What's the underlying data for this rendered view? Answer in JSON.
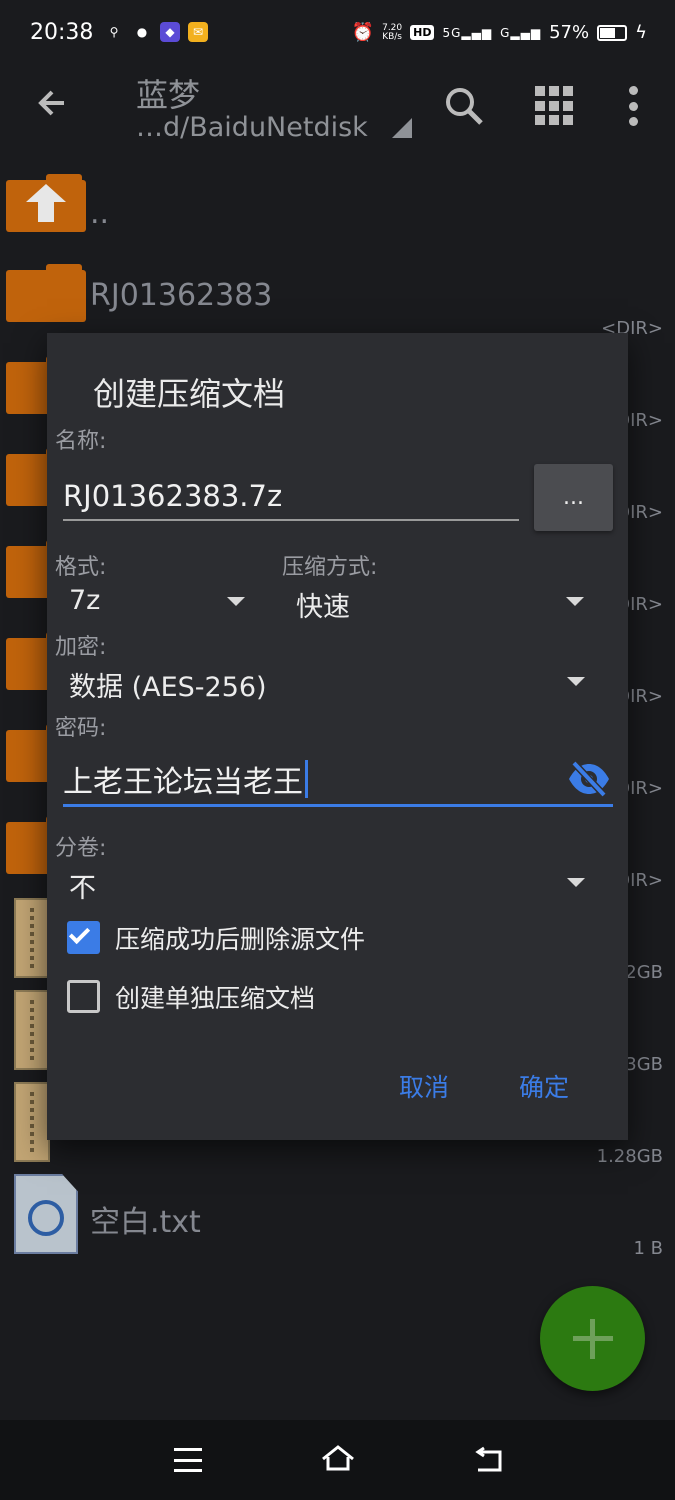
{
  "status_bar": {
    "time": "20:38",
    "net_speed_value": "7.20",
    "net_speed_unit": "KB/s",
    "hd_badge": "HD",
    "sim1": "5G",
    "sim2": "G",
    "battery_percent": "57%",
    "icons": [
      "usb-icon",
      "wechat-icon",
      "app-icon",
      "mail-icon",
      "alarm-icon",
      "charging-icon"
    ]
  },
  "toolbar": {
    "title": "蓝梦",
    "path": "…d/BaiduNetdisk"
  },
  "file_list": {
    "parent": "..",
    "items": [
      {
        "name": "RJ01362383",
        "size": "<DIR>"
      },
      {
        "name": "",
        "size": "DIR>"
      },
      {
        "name": "",
        "size": "DIR>"
      },
      {
        "name": "",
        "size": "DIR>"
      },
      {
        "name": "",
        "size": "DIR>"
      },
      {
        "name": "",
        "size": "DIR>"
      },
      {
        "name": "",
        "size": "DIR>"
      },
      {
        "name": "",
        "size": "2GB"
      },
      {
        "name": "",
        "size": "3GB"
      },
      {
        "name": "",
        "size": "1.28GB"
      },
      {
        "name": "空白.txt",
        "size": "1 B"
      }
    ]
  },
  "dialog": {
    "title": "创建压缩文档",
    "name_label": "名称:",
    "name_value": "RJ01362383.7z",
    "browse_label": "...",
    "format_label": "格式:",
    "format_value": "7z",
    "method_label": "压缩方式:",
    "method_value": "快速",
    "encryption_label": "加密:",
    "encryption_value": "数据 (AES-256)",
    "password_label": "密码:",
    "password_value": "上老王论坛当老王",
    "split_label": "分卷:",
    "split_value": "不",
    "delete_source_label": "压缩成功后删除源文件",
    "delete_source_checked": true,
    "separate_label": "创建单独压缩文档",
    "separate_checked": false,
    "cancel_label": "取消",
    "ok_label": "确定"
  },
  "colors": {
    "accent": "#3b7ce6",
    "folder": "#c0630c",
    "fab": "#2c7a11",
    "dialog_bg": "#2c2d31"
  }
}
